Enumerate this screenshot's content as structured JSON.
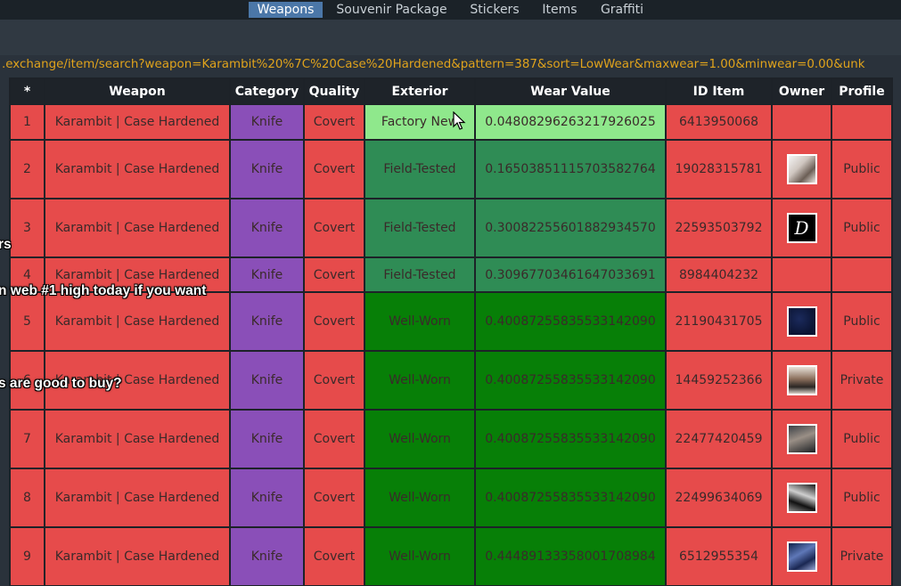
{
  "topnav": {
    "tabs": [
      {
        "label": "Weapons",
        "active": true
      },
      {
        "label": "Souvenir Package",
        "active": false
      },
      {
        "label": "Stickers",
        "active": false
      },
      {
        "label": "Items",
        "active": false
      },
      {
        "label": "Graffiti",
        "active": false
      }
    ]
  },
  "url": {
    "text": ".exchange/item/search?weapon=Karambit%20%7C%20Case%20Hardened&pattern=387&sort=LowWear&maxwear=1.00&minwear=0.00&unk"
  },
  "table": {
    "headers": [
      "*",
      "Weapon",
      "Category",
      "Quality",
      "Exterior",
      "Wear Value",
      "ID Item",
      "Owner",
      "Profile"
    ],
    "rows": [
      {
        "num": "1",
        "weapon": "Karambit | Case Hardened",
        "category": "Knife",
        "quality": "Covert",
        "exterior": "Factory New",
        "wear": "0.04808296263217926025",
        "id": "6413950068",
        "owner_avatar": "none",
        "profile": ""
      },
      {
        "num": "2",
        "weapon": "Karambit | Case Hardened",
        "category": "Knife",
        "quality": "Covert",
        "exterior": "Field-Tested",
        "wear": "0.16503851115703582764",
        "id": "19028315781",
        "owner_avatar": "bird-avatar",
        "profile": "Public"
      },
      {
        "num": "3",
        "weapon": "Karambit | Case Hardened",
        "category": "Knife",
        "quality": "Covert",
        "exterior": "Field-Tested",
        "wear": "0.30082255601882934570",
        "id": "22593503792",
        "owner_avatar": "letter-d-avatar",
        "profile": "Public"
      },
      {
        "num": "4",
        "weapon": "Karambit | Case Hardened",
        "category": "Knife",
        "quality": "Covert",
        "exterior": "Field-Tested",
        "wear": "0.30967703461647033691",
        "id": "8984404232",
        "owner_avatar": "none",
        "profile": ""
      },
      {
        "num": "5",
        "weapon": "Karambit | Case Hardened",
        "category": "Knife",
        "quality": "Covert",
        "exterior": "Well-Worn",
        "wear": "0.40087255835533142090",
        "id": "21190431705",
        "owner_avatar": "night-sky-avatar",
        "profile": "Public"
      },
      {
        "num": "6",
        "weapon": "Karambit | Case Hardened",
        "category": "Knife",
        "quality": "Covert",
        "exterior": "Well-Worn",
        "wear": "0.40087255835533142090",
        "id": "14459252366",
        "owner_avatar": "person-avatar",
        "profile": "Private"
      },
      {
        "num": "7",
        "weapon": "Karambit | Case Hardened",
        "category": "Knife",
        "quality": "Covert",
        "exterior": "Well-Worn",
        "wear": "0.40087255835533142090",
        "id": "22477420459",
        "owner_avatar": "man-avatar",
        "profile": "Public"
      },
      {
        "num": "8",
        "weapon": "Karambit | Case Hardened",
        "category": "Knife",
        "quality": "Covert",
        "exterior": "Well-Worn",
        "wear": "0.40087255835533142090",
        "id": "22499634069",
        "owner_avatar": "character-avatar",
        "profile": "Public"
      },
      {
        "num": "9",
        "weapon": "Karambit | Case Hardened",
        "category": "Knife",
        "quality": "Covert",
        "exterior": "Well-Worn",
        "wear": "0.44489133358001708984",
        "id": "6512955354",
        "owner_avatar": "space-avatar",
        "profile": "Private"
      }
    ]
  },
  "overlay": {
    "line1": "rs",
    "line2": "n web #1 high today if you want",
    "line3": "s are good to buy?"
  },
  "colors": {
    "row_red": "#e64b4b",
    "category_purple": "#8a4fb8",
    "factory_new": "#8fe88c",
    "field_tested": "#2f8c55",
    "well_worn": "#077f07",
    "url_orange": "#e0a31c",
    "active_tab": "#4b77a8"
  }
}
